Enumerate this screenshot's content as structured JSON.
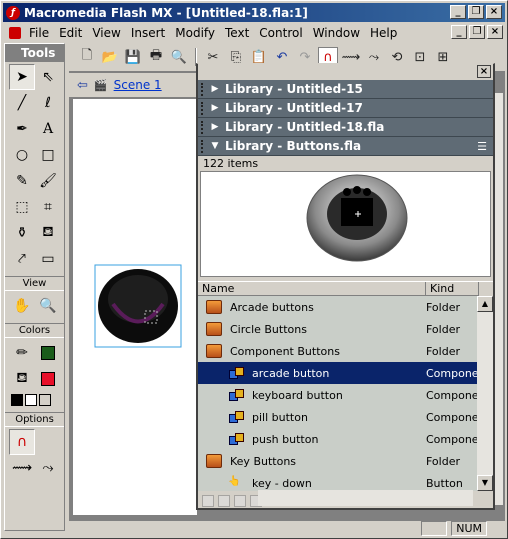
{
  "window": {
    "title": "Macromedia Flash MX - [Untitled-18.fla:1]",
    "app_icon": "flash-icon",
    "buttons": [
      "_",
      "❐",
      "×"
    ],
    "doc_buttons": [
      "_",
      "❐",
      "×"
    ]
  },
  "menu": [
    "File",
    "Edit",
    "View",
    "Insert",
    "Modify",
    "Text",
    "Control",
    "Window",
    "Help"
  ],
  "tools": {
    "title": "Tools",
    "view_label": "View",
    "colors_label": "Colors",
    "options_label": "Options",
    "stroke_color": "#1a5c1a",
    "fill_color": "#e8102a"
  },
  "scene": {
    "label": "Scene 1"
  },
  "library": {
    "collapsed": [
      "Library - Untitled-15",
      "Library - Untitled-17",
      "Library - Untitled-18.fla"
    ],
    "active": "Library - Buttons.fla",
    "count": "122 items",
    "col_name": "Name",
    "col_kind": "Kind",
    "rows": [
      {
        "name": "Arcade buttons",
        "kind": "Folder",
        "type": "folder",
        "indent": 0,
        "selected": false
      },
      {
        "name": "Circle Buttons",
        "kind": "Folder",
        "type": "folder",
        "indent": 0,
        "selected": false
      },
      {
        "name": "Component Buttons",
        "kind": "Folder",
        "type": "folder-open",
        "indent": 0,
        "selected": false
      },
      {
        "name": "arcade button",
        "kind": "Component",
        "type": "component",
        "indent": 1,
        "selected": true
      },
      {
        "name": "keyboard button",
        "kind": "Component",
        "type": "component",
        "indent": 1,
        "selected": false
      },
      {
        "name": "pill button",
        "kind": "Component",
        "type": "component",
        "indent": 1,
        "selected": false
      },
      {
        "name": "push button",
        "kind": "Component",
        "type": "component",
        "indent": 1,
        "selected": false
      },
      {
        "name": "Key Buttons",
        "kind": "Folder",
        "type": "folder-open",
        "indent": 0,
        "selected": false
      },
      {
        "name": "key - down",
        "kind": "Button",
        "type": "button",
        "indent": 1,
        "selected": false
      }
    ]
  },
  "status": {
    "num": "NUM"
  }
}
